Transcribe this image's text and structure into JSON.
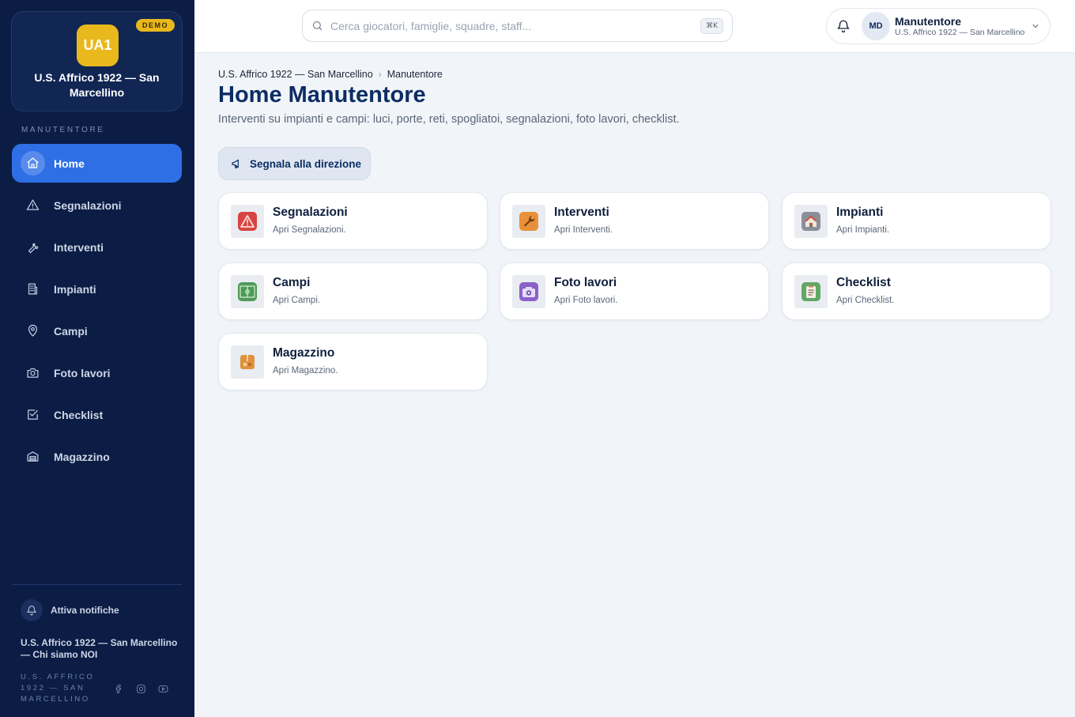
{
  "sidebar": {
    "club_logo": "UA1",
    "demo_badge": "DEMO",
    "club_name": "U.S. Affrico 1922 — San Marcellino",
    "section_label": "MANUTENTORE",
    "nav": [
      {
        "label": "Home",
        "icon": "home-icon",
        "active": true
      },
      {
        "label": "Segnalazioni",
        "icon": "warning-icon",
        "active": false
      },
      {
        "label": "Interventi",
        "icon": "wrench-icon",
        "active": false
      },
      {
        "label": "Impianti",
        "icon": "building-icon",
        "active": false
      },
      {
        "label": "Campi",
        "icon": "map-pin-icon",
        "active": false
      },
      {
        "label": "Foto lavori",
        "icon": "camera-icon",
        "active": false
      },
      {
        "label": "Checklist",
        "icon": "checkbox-icon",
        "active": false
      },
      {
        "label": "Magazzino",
        "icon": "warehouse-icon",
        "active": false
      }
    ],
    "notifications_label": "Attiva notifiche",
    "footer_club": "U.S. Affrico 1922 — San Marcellino — Chi siamo NOI",
    "footer_small": "U.S. AFFRICO 1922 — SAN MARCELLINO",
    "socials": [
      "facebook-icon",
      "instagram-icon",
      "youtube-icon"
    ]
  },
  "topbar": {
    "search_placeholder": "Cerca giocatori, famiglie, squadre, staff...",
    "search_value": "",
    "shortcut": "⌘K",
    "user": {
      "initials": "MD",
      "name": "Manutentore",
      "org": "U.S. Affrico 1922 — San Marcellino"
    }
  },
  "main": {
    "breadcrumb": [
      "U.S. Affrico 1922 — San Marcellino",
      "Manutentore"
    ],
    "title": "Home Manutentore",
    "subtitle": "Interventi su impianti e campi: luci, porte, reti, spogliatoi, segnalazioni, foto lavori, checklist.",
    "action_label": "Segnala alla direzione",
    "cards": [
      {
        "title": "Segnalazioni",
        "sub": "Apri Segnalazioni.",
        "icon": "warning-tile-icon",
        "color": "#d64541"
      },
      {
        "title": "Interventi",
        "sub": "Apri Interventi.",
        "icon": "wrench-tile-icon",
        "color": "#e8913a"
      },
      {
        "title": "Impianti",
        "sub": "Apri Impianti.",
        "icon": "house-tile-icon",
        "color": "#8a8f99"
      },
      {
        "title": "Campi",
        "sub": "Apri Campi.",
        "icon": "field-tile-icon",
        "color": "#4f9a5a"
      },
      {
        "title": "Foto lavori",
        "sub": "Apri Foto lavori.",
        "icon": "camera-tile-icon",
        "color": "#8a62c9"
      },
      {
        "title": "Checklist",
        "sub": "Apri Checklist.",
        "icon": "clipboard-tile-icon",
        "color": "#5fa866"
      },
      {
        "title": "Magazzino",
        "sub": "Apri Magazzino.",
        "icon": "box-tile-icon",
        "color": "#e0913d"
      }
    ]
  }
}
